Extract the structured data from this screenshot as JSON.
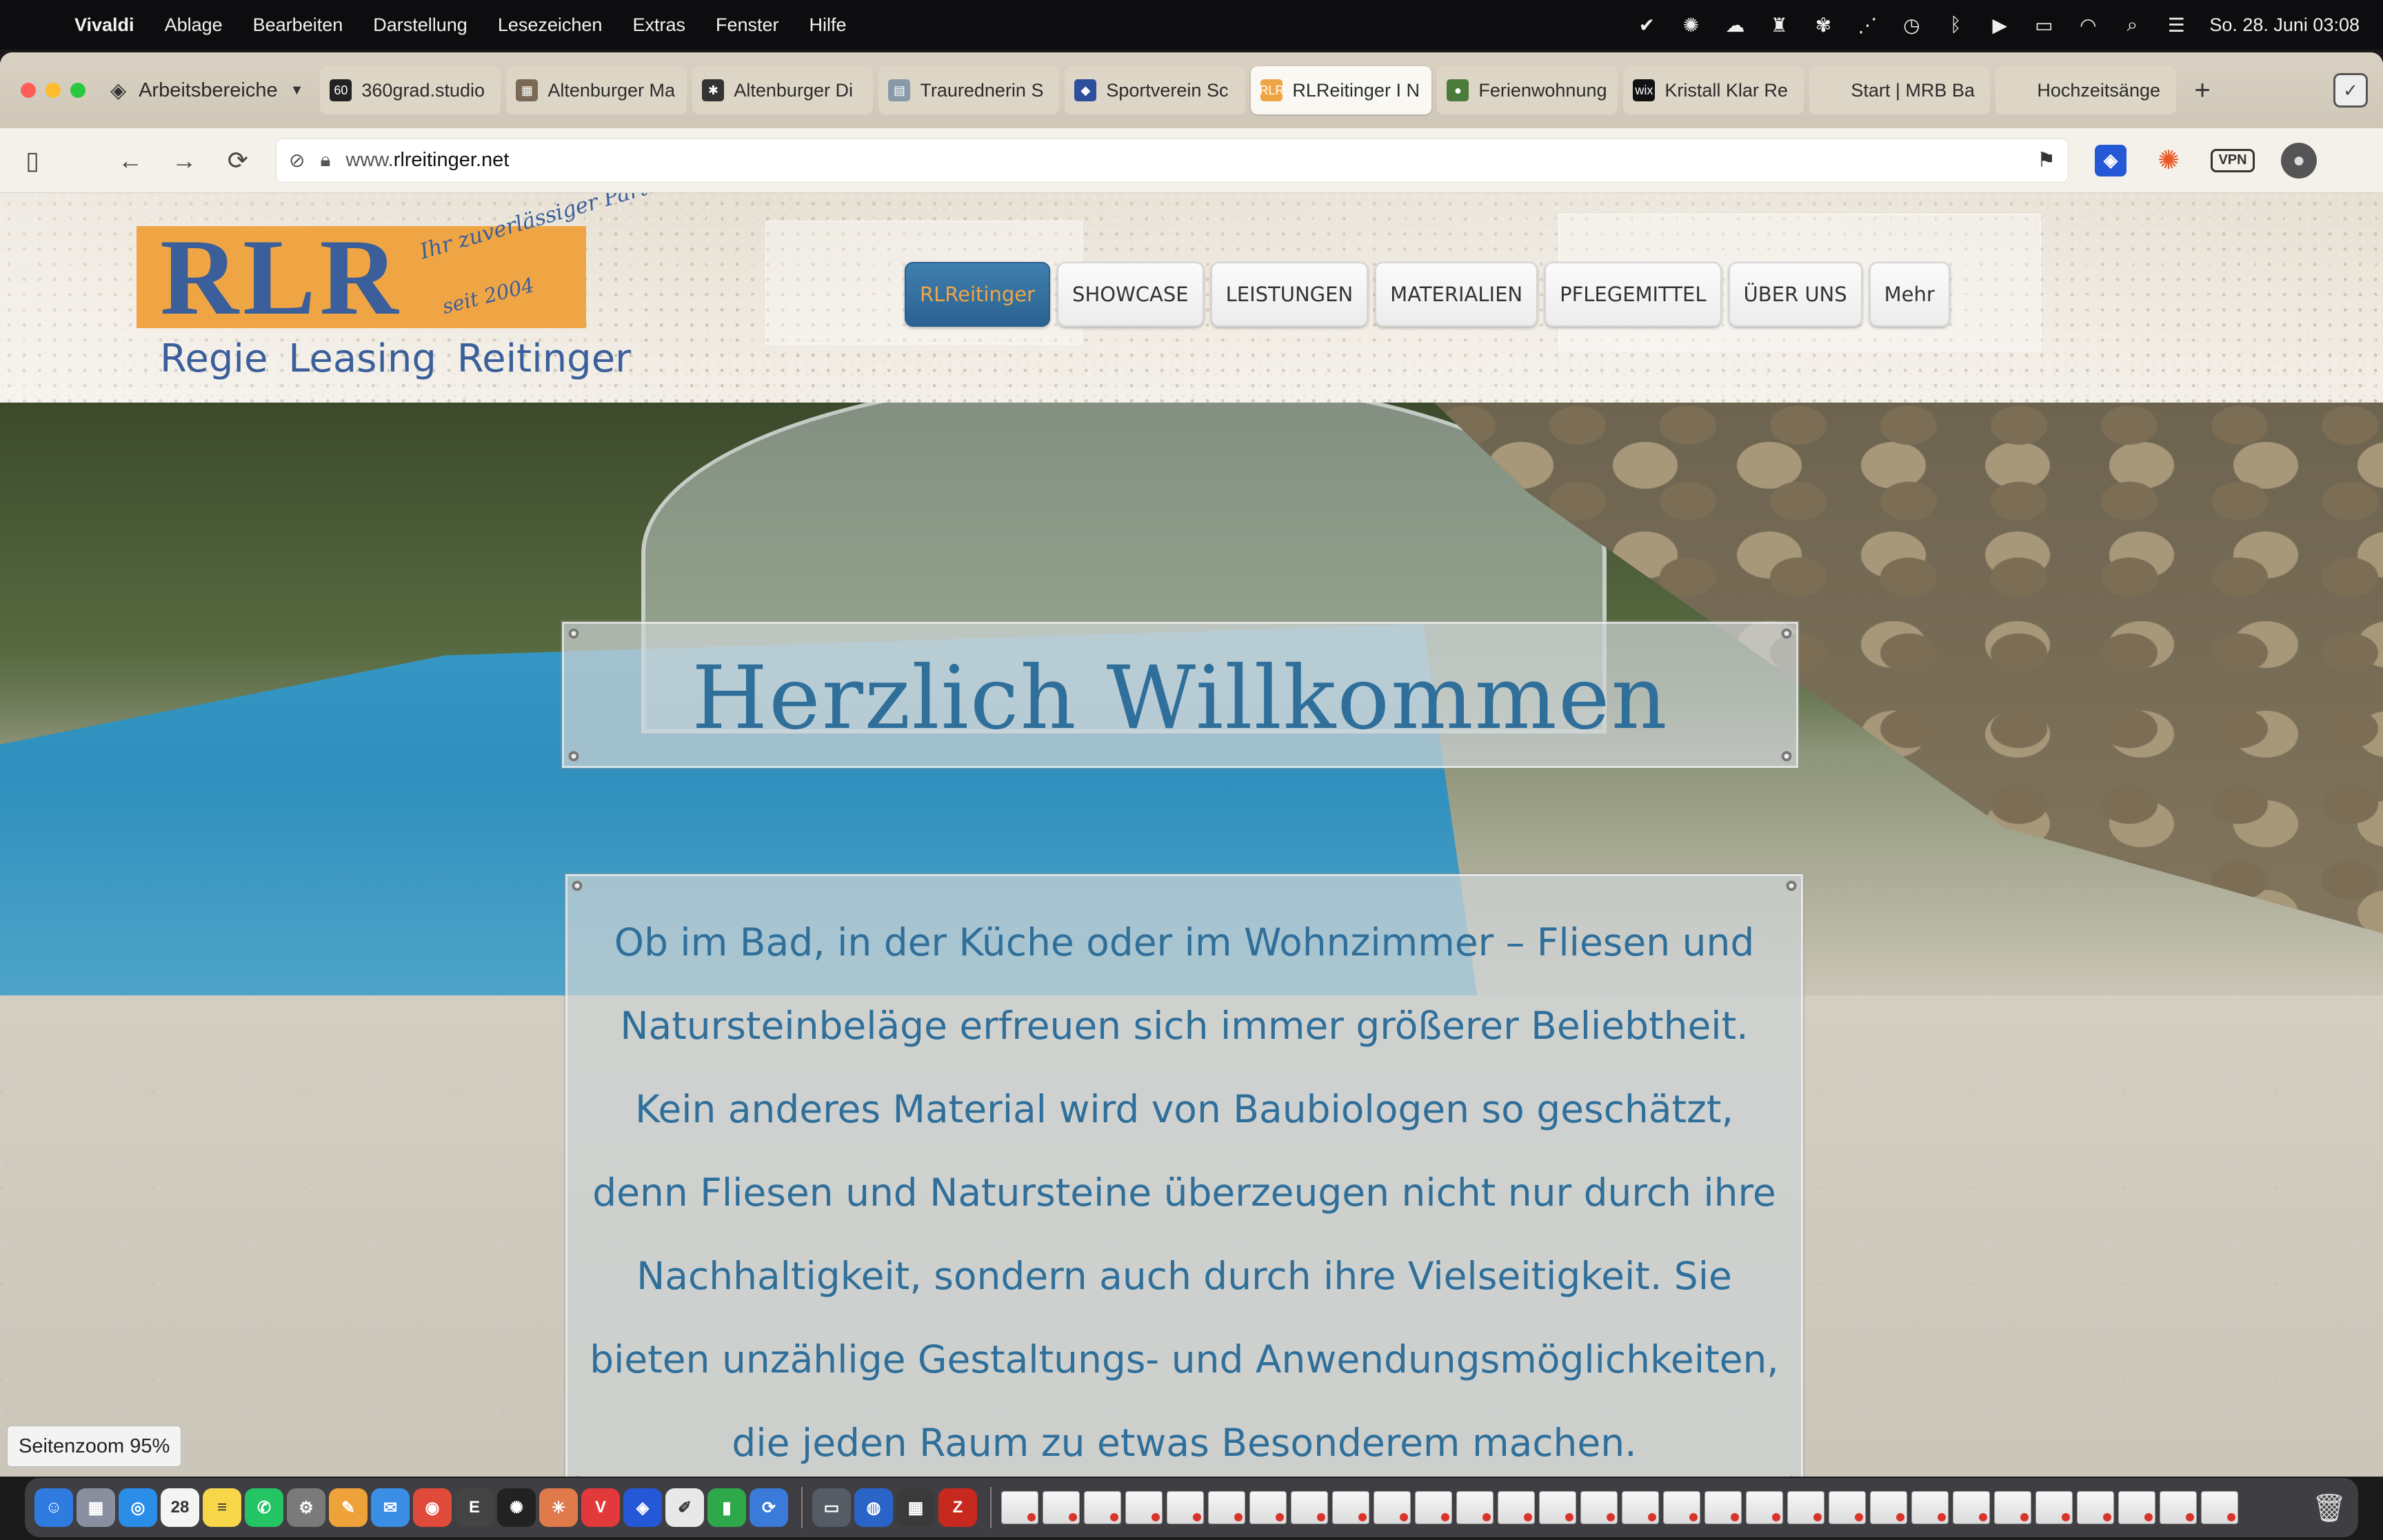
{
  "menubar": {
    "app": "Vivaldi",
    "items": [
      "Ablage",
      "Bearbeiten",
      "Darstellung",
      "Lesezeichen",
      "Extras",
      "Fenster",
      "Hilfe"
    ],
    "clock": "So. 28. Juni  03:08"
  },
  "browser": {
    "workspace_label": "Arbeitsbereiche",
    "tabs": [
      {
        "label": "360grad.studio",
        "fav": "60",
        "fav_color": "#222222"
      },
      {
        "label": "Altenburger Ma",
        "fav": "▦",
        "fav_color": "#7a6a55"
      },
      {
        "label": "Altenburger Di",
        "fav": "✱",
        "fav_color": "#333333"
      },
      {
        "label": "Traurednerin S",
        "fav": "▤",
        "fav_color": "#8899aa"
      },
      {
        "label": "Sportverein Sc",
        "fav": "◆",
        "fav_color": "#2c4f9e"
      },
      {
        "label": "RLReitinger I N",
        "fav": "RLR",
        "fav_color": "#f0a545"
      },
      {
        "label": "Ferienwohnung",
        "fav": "●",
        "fav_color": "#4b7a3a"
      },
      {
        "label": "Kristall Klar Re",
        "fav": "wix",
        "fav_color": "#111111"
      },
      {
        "label": "Start | MRB Ba",
        "fav": "",
        "fav_color": "#ddd5c6"
      },
      {
        "label": "Hochzeitsänge",
        "fav": "",
        "fav_color": "#ddd5c6"
      }
    ],
    "active_tab_index": 5,
    "url_prefix": "www.",
    "url_host": "rlreitinger.net",
    "zoom_badge": "Seitenzoom 95%"
  },
  "site": {
    "logo_letters": "RLR",
    "logo_tagline": "Ihr zuverlässiger Partner",
    "logo_since": "seit 2004",
    "logo_subtitle": "Regie Leasing Reitinger",
    "nav": [
      "RLReitinger",
      "SHOWCASE",
      "LEISTUNGEN",
      "MATERIALIEN",
      "PFLEGEMITTEL",
      "ÜBER UNS",
      "Mehr"
    ],
    "nav_active": 0,
    "hero_title": "Herzlich Willkommen",
    "hero_lines": [
      "Ob im Bad, in der Küche oder im Wohnzimmer – Fliesen und",
      "Natursteinbeläge erfreuen sich immer größerer Beliebtheit.",
      "Kein anderes Material wird von Baubiologen so geschätzt,",
      "denn Fliesen und Natursteine überzeugen nicht nur durch ihre",
      "Nachhaltigkeit, sondern auch durch ihre Vielseitigkeit. Sie",
      "bieten unzählige Gestaltungs- und Anwendungsmöglichkeiten,",
      "die jeden Raum zu etwas Besonderem machen."
    ],
    "brand_orange": "#f0a545",
    "brand_blue": "#3a5f9b"
  },
  "dock": {
    "apps": [
      {
        "name": "finder-icon",
        "glyph": "☺",
        "color": "#2f7be0"
      },
      {
        "name": "launchpad-icon",
        "glyph": "▦",
        "color": "#8a8fa0"
      },
      {
        "name": "safari-icon",
        "glyph": "◎",
        "color": "#2a8de8"
      },
      {
        "name": "calendar-icon",
        "glyph": "28",
        "color": "#f4f4f4"
      },
      {
        "name": "notes-icon",
        "glyph": "≡",
        "color": "#f7d64a"
      },
      {
        "name": "whatsapp-icon",
        "glyph": "✆",
        "color": "#25c464"
      },
      {
        "name": "settings-icon",
        "glyph": "⚙",
        "color": "#7a7a7a"
      },
      {
        "name": "pages-icon",
        "glyph": "✎",
        "color": "#f0a23a"
      },
      {
        "name": "mail-icon",
        "glyph": "✉",
        "color": "#3b8ee6"
      },
      {
        "name": "chrome-icon",
        "glyph": "◉",
        "color": "#e04a3a"
      },
      {
        "name": "ertha-icon",
        "glyph": "E",
        "color": "#444444"
      },
      {
        "name": "openai-icon",
        "glyph": "✺",
        "color": "#222222"
      },
      {
        "name": "claude-icon",
        "glyph": "✳",
        "color": "#e07a4a"
      },
      {
        "name": "vivaldi-icon",
        "glyph": "V",
        "color": "#e23a3a"
      },
      {
        "name": "bitwarden-icon",
        "glyph": "◈",
        "color": "#2458d6"
      },
      {
        "name": "textedit-icon",
        "glyph": "✐",
        "color": "#e8e8e8"
      },
      {
        "name": "numbers-icon",
        "glyph": "▮",
        "color": "#2ea84a"
      },
      {
        "name": "sync-icon",
        "glyph": "⟳",
        "color": "#3a7ad8"
      }
    ],
    "apps2": [
      {
        "name": "disk-icon",
        "glyph": "▭",
        "color": "#555c66"
      },
      {
        "name": "globe-icon",
        "glyph": "◍",
        "color": "#2b64c8"
      },
      {
        "name": "calculator-icon",
        "glyph": "▦",
        "color": "#3a3a3a"
      },
      {
        "name": "filezilla-icon",
        "glyph": "Z",
        "color": "#c8291f"
      }
    ],
    "window_count": 30
  }
}
